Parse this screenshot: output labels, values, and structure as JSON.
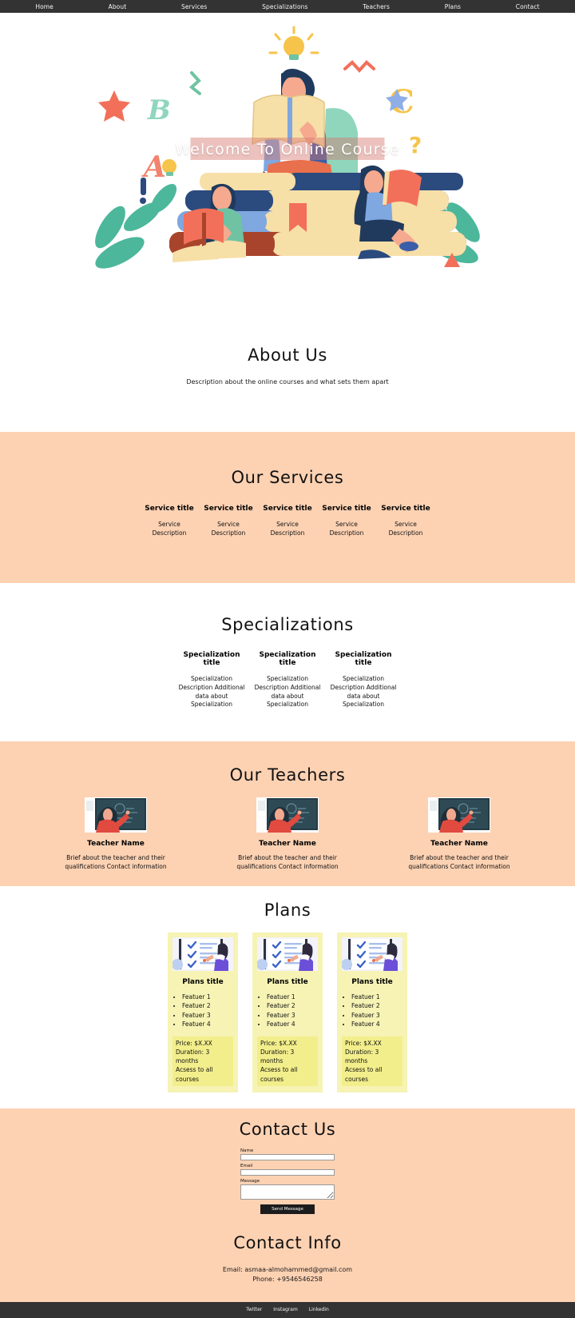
{
  "nav": {
    "items": [
      {
        "label": "Home"
      },
      {
        "label": "About"
      },
      {
        "label": "Services"
      },
      {
        "label": "Specializations"
      },
      {
        "label": "Teachers"
      },
      {
        "label": "Plans"
      },
      {
        "label": "Contact"
      }
    ]
  },
  "hero": {
    "title": "Welcome To Online Course"
  },
  "about": {
    "title": "About Us",
    "description": "Description about the online courses and what sets them apart"
  },
  "services": {
    "title": "Our Services",
    "items": [
      {
        "title": "Service title",
        "desc": "Service Description"
      },
      {
        "title": "Service title",
        "desc": "Service Description"
      },
      {
        "title": "Service title",
        "desc": "Service Description"
      },
      {
        "title": "Service title",
        "desc": "Service Description"
      },
      {
        "title": "Service title",
        "desc": "Service Description"
      }
    ]
  },
  "specializations": {
    "title": "Specializations",
    "items": [
      {
        "title": "Specialization title",
        "desc": "Specialization Description Additional data about Specialization"
      },
      {
        "title": "Specialization title",
        "desc": "Specialization Description Additional data about Specialization"
      },
      {
        "title": "Specialization title",
        "desc": "Specialization Description Additional data about Specialization"
      }
    ]
  },
  "teachers": {
    "title": "Our Teachers",
    "items": [
      {
        "name": "Teacher Name",
        "desc": "Brief about the teacher and their qualifications Contact information"
      },
      {
        "name": "Teacher Name",
        "desc": "Brief about the teacher and their qualifications Contact information"
      },
      {
        "name": "Teacher Name",
        "desc": "Brief about the teacher and their qualifications Contact information"
      }
    ]
  },
  "plans": {
    "title": "Plans",
    "items": [
      {
        "title": "Plans title",
        "features": [
          "Featuer 1",
          "Featuer 2",
          "Featuer 3",
          "Featuer 4"
        ],
        "price": "Price: $X.XX",
        "duration": "Duration: 3 months",
        "access": "Acsess to all courses"
      },
      {
        "title": "Plans title",
        "features": [
          "Featuer 1",
          "Featuer 2",
          "Featuer 3",
          "Featuer 4"
        ],
        "price": "Price: $X.XX",
        "duration": "Duration: 3 months",
        "access": "Acsess to all courses"
      },
      {
        "title": "Plans title",
        "features": [
          "Featuer 1",
          "Featuer 2",
          "Featuer 3",
          "Featuer 4"
        ],
        "price": "Price: $X.XX",
        "duration": "Duration: 3 months",
        "access": "Acsess to all courses"
      }
    ]
  },
  "contact": {
    "title": "Contact Us",
    "name_label": "Name",
    "name_value": "",
    "email_label": "Email",
    "email_value": "",
    "message_label": "Message",
    "message_value": "",
    "submit_label": "Send Message"
  },
  "contact_info": {
    "title": "Contact Info",
    "email": "Email: asmaa-almohammed@gmail.com",
    "phone": "Phone: +9546546258"
  },
  "footer": {
    "links": [
      {
        "label": "Twitter"
      },
      {
        "label": "Instagram"
      },
      {
        "label": "Linkedin"
      }
    ]
  },
  "colors": {
    "nav_bg": "#333333",
    "peach_bg": "#FDD2B3",
    "plan_bg": "#F6F3B4",
    "plan_price_bg": "#F2EE8B",
    "button_bg": "#1c1c1c"
  }
}
